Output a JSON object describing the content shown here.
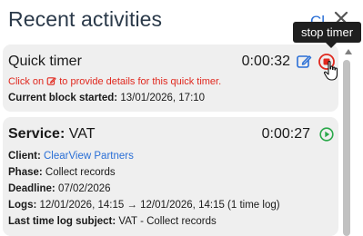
{
  "header": {
    "title": "Recent activities",
    "partial_link": "Cl",
    "close_icon": "close-icon"
  },
  "tooltip": {
    "text": "stop timer"
  },
  "quick_timer": {
    "name": "Quick timer",
    "elapsed": "0:00:32",
    "hint_prefix": "Click on",
    "hint_suffix": "to provide details for this quick timer.",
    "block_label": "Current block started:",
    "block_value": "13/01/2026, 17:10",
    "edit_icon": "edit-icon",
    "stop_icon": "stop-icon"
  },
  "service": {
    "label": "Service:",
    "name": "VAT",
    "elapsed": "0:00:27",
    "play_icon": "play-icon",
    "client_label": "Client:",
    "client_value": "ClearView Partners",
    "phase_label": "Phase:",
    "phase_value": "Collect records",
    "deadline_label": "Deadline:",
    "deadline_value": "07/02/2026",
    "logs_label": "Logs:",
    "logs_value": "12/01/2026, 14:15 → 12/01/2026, 14:15 (1 time log)",
    "subject_label": "Last time log subject:",
    "subject_value": "VAT - Collect records"
  },
  "colors": {
    "hint_red": "#e0281e",
    "link_blue": "#2a6fd6",
    "stop_red": "#e0281e",
    "play_green": "#2aa84a",
    "tooltip_bg": "#1f1f1f"
  }
}
